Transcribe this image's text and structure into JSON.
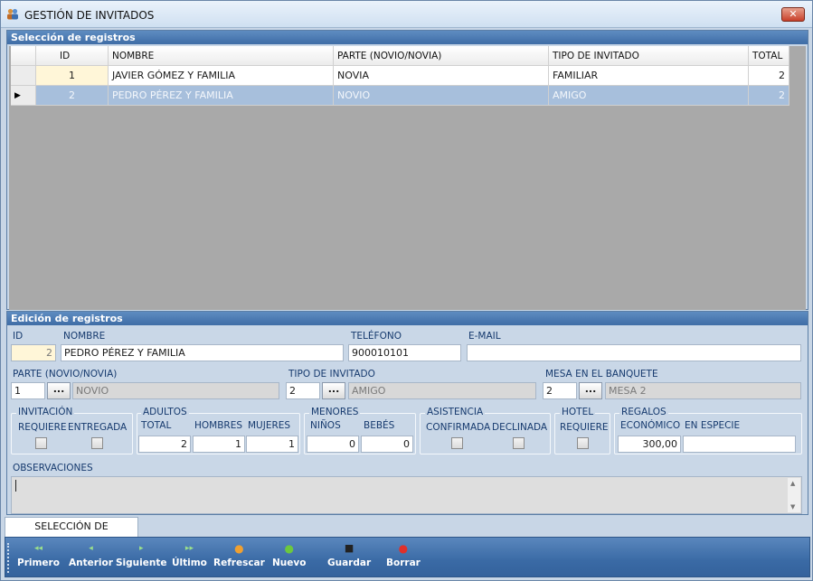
{
  "window": {
    "title": "GESTIÓN DE INVITADOS",
    "close_glyph": "✕"
  },
  "selection_panel": {
    "title": "Selección de registros",
    "columns": [
      "ID",
      "NOMBRE",
      "PARTE (NOVIO/NOVIA)",
      "TIPO DE INVITADO",
      "TOTAL"
    ],
    "rows": [
      {
        "id": "1",
        "nombre": "JAVIER GÓMEZ Y FAMILIA",
        "parte": "NOVIA",
        "tipo": "FAMILIAR",
        "total": "2"
      },
      {
        "id": "2",
        "nombre": "PEDRO PÉREZ Y FAMILIA",
        "parte": "NOVIO",
        "tipo": "AMIGO",
        "total": "2"
      }
    ],
    "current_row_marker": "▶"
  },
  "edit_panel": {
    "title": "Edición de registros",
    "labels": {
      "id": "ID",
      "nombre": "NOMBRE",
      "telefono": "TELÉFONO",
      "email": "E-MAIL",
      "parte": "PARTE (NOVIO/NOVIA)",
      "tipo": "TIPO DE INVITADO",
      "mesa": "MESA EN EL BANQUETE",
      "invitacion": "INVITACIÓN",
      "requiere": "REQUIERE",
      "entregada": "ENTREGADA",
      "adultos": "ADULTOS",
      "total": "TOTAL",
      "hombres": "HOMBRES",
      "mujeres": "MUJERES",
      "menores": "MENORES",
      "ninos": "NIÑOS",
      "bebes": "BEBÉS",
      "asistencia": "ASISTENCIA",
      "confirmada": "CONFIRMADA",
      "declinada": "DECLINADA",
      "hotel": "HOTEL",
      "hotel_requiere": "REQUIERE",
      "regalos": "REGALOS",
      "economico": "ECONÓMICO",
      "especie": "EN ESPECIE",
      "observaciones": "OBSERVACIONES"
    },
    "values": {
      "id": "2",
      "nombre": "PEDRO PÉREZ Y FAMILIA",
      "telefono": "900010101",
      "email": "",
      "parte_id": "1",
      "parte_text": "NOVIO",
      "tipo_id": "2",
      "tipo_text": "AMIGO",
      "mesa_id": "2",
      "mesa_text": "MESA 2",
      "adultos_total": "2",
      "hombres": "1",
      "mujeres": "1",
      "ninos": "0",
      "bebes": "0",
      "economico": "300,00",
      "especie": "",
      "observaciones": ""
    },
    "lookup_button": "..."
  },
  "tabs": [
    {
      "label": "SELECCIÓN DE REGISTROS"
    }
  ],
  "toolbar": {
    "items": [
      {
        "label": "Primero",
        "icon": "first-icon",
        "glyph": "◂◂",
        "color": "#9be08a"
      },
      {
        "label": "Anterior",
        "icon": "prev-icon",
        "glyph": "◂",
        "color": "#9be08a"
      },
      {
        "label": "Siguiente",
        "icon": "next-icon",
        "glyph": "▸",
        "color": "#9be08a"
      },
      {
        "label": "Último",
        "icon": "last-icon",
        "glyph": "▸▸",
        "color": "#9be08a"
      },
      {
        "label": "Refrescar",
        "icon": "refresh-icon",
        "glyph": "●",
        "color": "#f0a030"
      },
      {
        "label": "Nuevo",
        "icon": "add-icon",
        "glyph": "●",
        "color": "#6cc83e"
      },
      {
        "label": "Guardar",
        "icon": "save-icon",
        "glyph": "■",
        "color": "#222222"
      },
      {
        "label": "Borrar",
        "icon": "delete-icon",
        "glyph": "●",
        "color": "#e0302a"
      }
    ]
  }
}
